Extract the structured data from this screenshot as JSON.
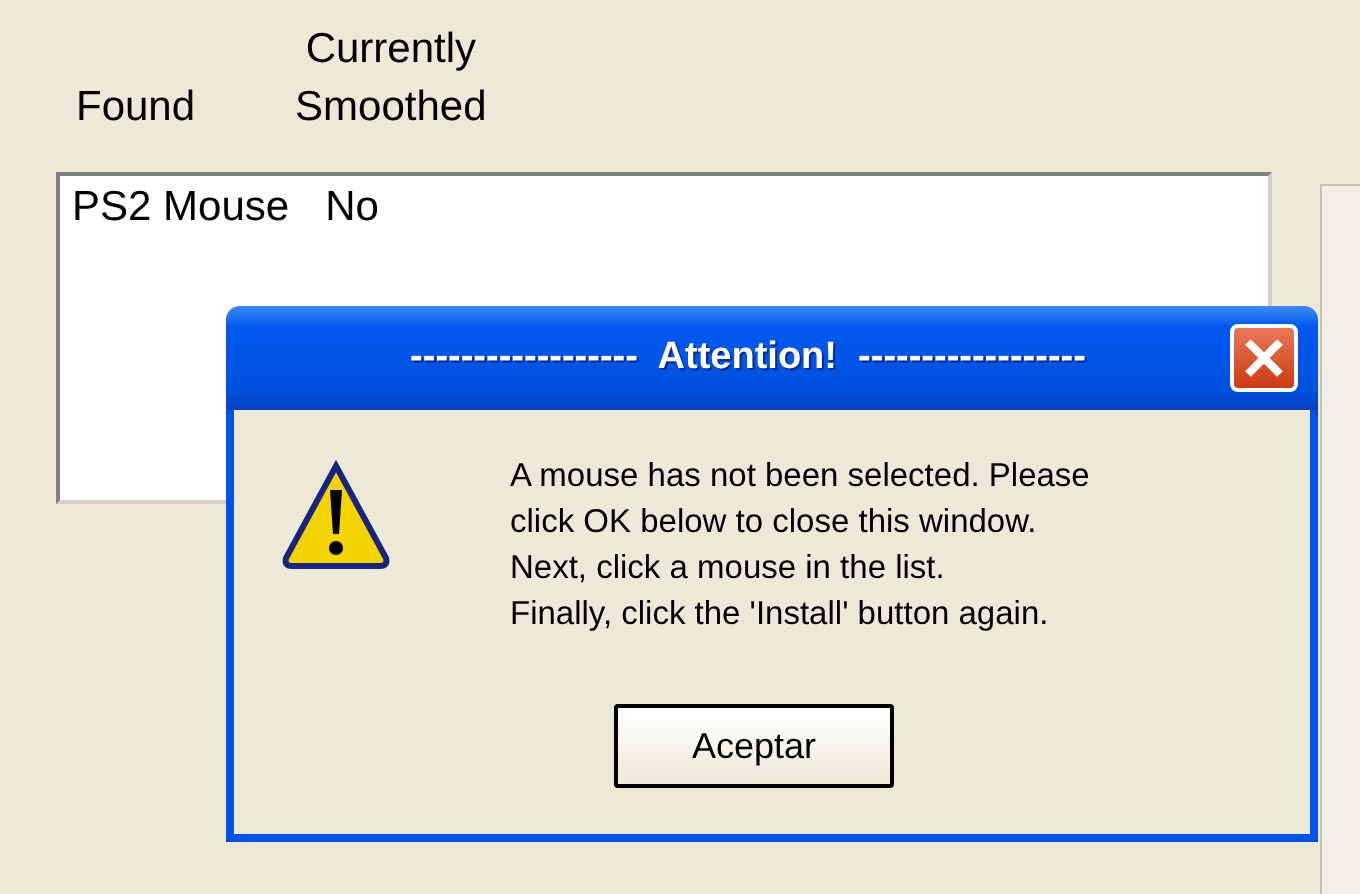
{
  "columns": [
    {
      "lines": [
        "Found"
      ]
    },
    {
      "lines": [
        "Currently",
        "Smoothed"
      ]
    }
  ],
  "list": {
    "rows": [
      {
        "cells": [
          "PS2 Mouse",
          "No"
        ]
      }
    ]
  },
  "dialog": {
    "title": "------------------  Attention!  ------------------",
    "message": [
      "A mouse has not been selected. Please",
      "click OK below to close this window.",
      "Next, click a mouse in the list.",
      "Finally, click the 'Install' button again."
    ],
    "kind": "warning",
    "button": "Aceptar"
  }
}
